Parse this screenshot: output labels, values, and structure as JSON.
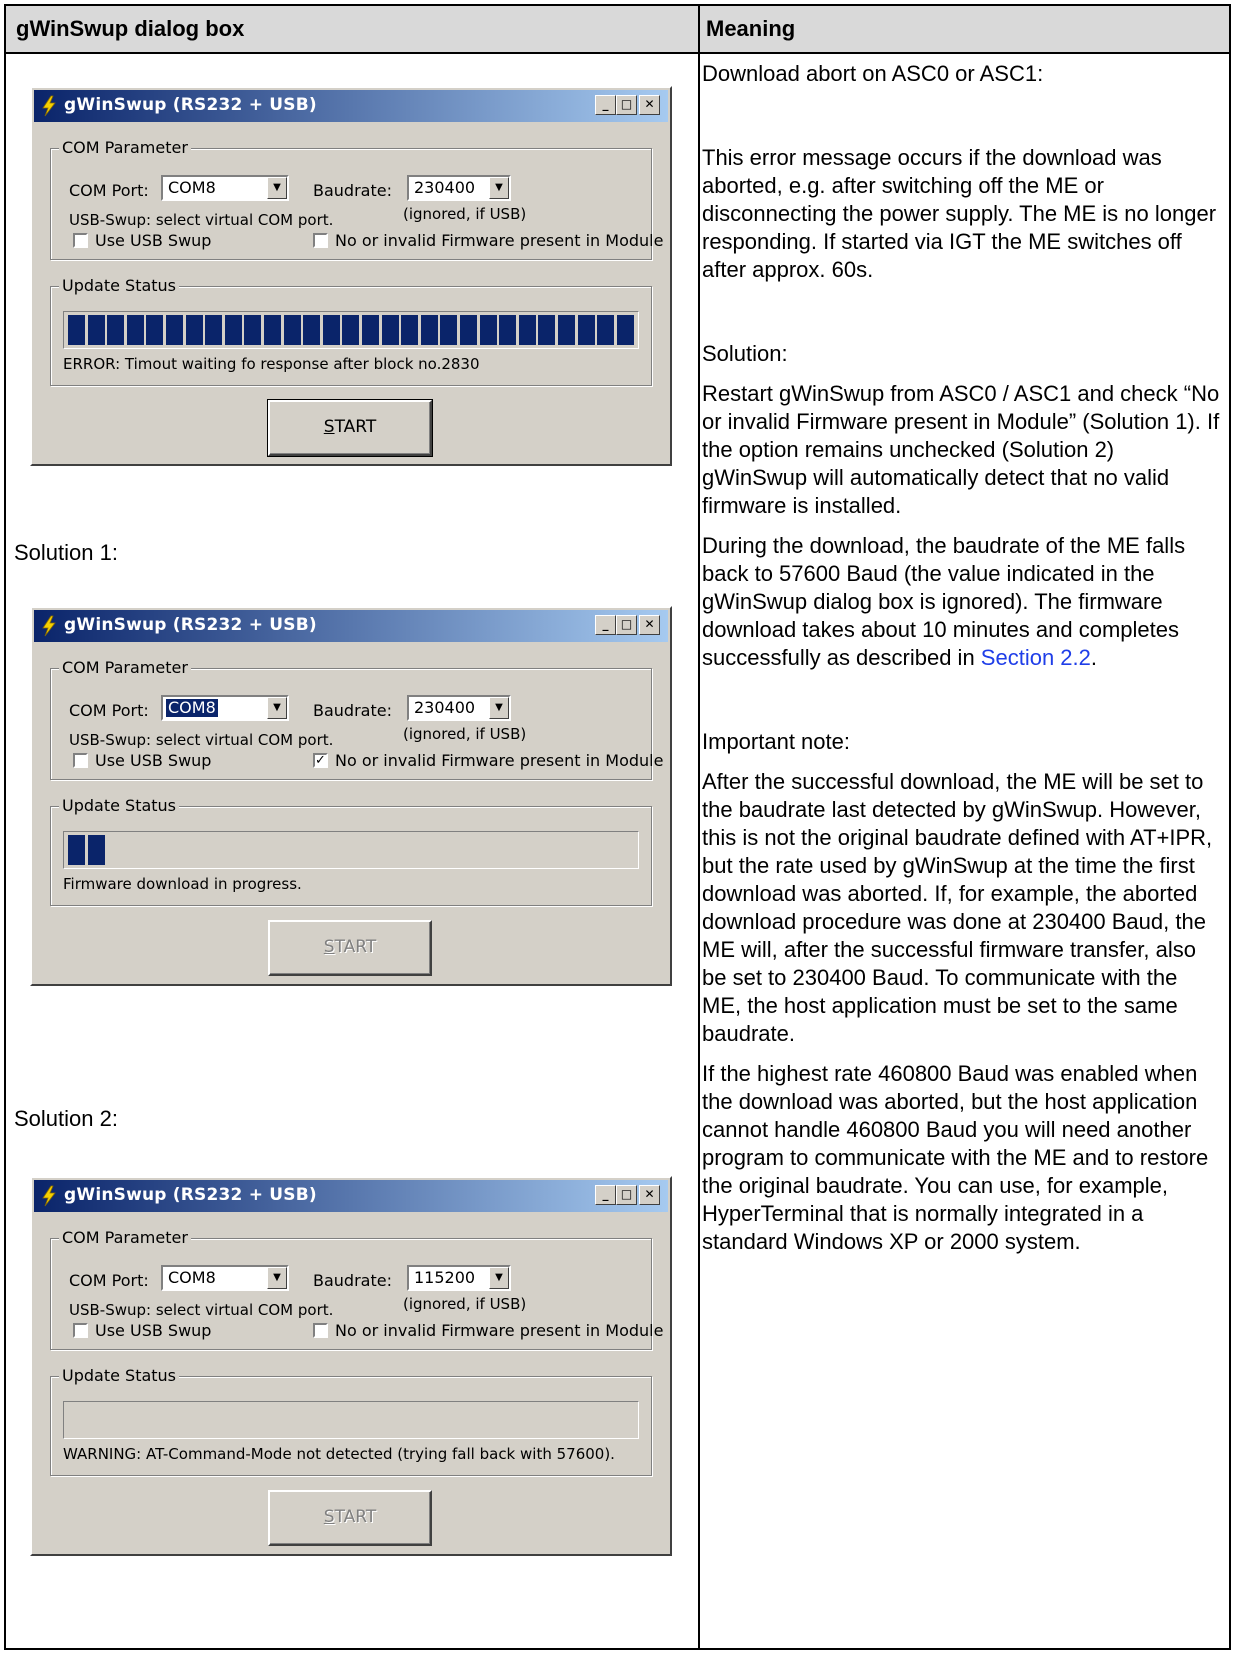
{
  "table": {
    "col1_header": "gWinSwup dialog box",
    "col2_header": "Meaning"
  },
  "dialogs": [
    {
      "title": "gWinSwup (RS232 + USB)",
      "com_group": "COM Parameter",
      "com_port_label": "COM Port:",
      "com_port_value": "COM8",
      "baudrate_label": "Baudrate:",
      "baudrate_value": "230400",
      "usb_hint": "USB-Swup: select virtual COM port.",
      "ignored_hint": "(ignored, if USB)",
      "use_usb_label": "Use USB Swup",
      "use_usb_checked": false,
      "no_fw_label": "No or invalid Firmware present in Module",
      "no_fw_checked": false,
      "status_group": "Update Status",
      "progress_segments": 29,
      "status_text": "ERROR: Timout waiting fo response after block no.2830",
      "start_label": "START",
      "start_accel": "S",
      "start_rest": "TART",
      "start_enabled": true
    },
    {
      "title": "gWinSwup (RS232 + USB)",
      "com_group": "COM Parameter",
      "com_port_label": "COM Port:",
      "com_port_value": "COM8",
      "baudrate_label": "Baudrate:",
      "baudrate_value": "230400",
      "usb_hint": "USB-Swup: select virtual COM port.",
      "ignored_hint": "(ignored, if USB)",
      "use_usb_label": "Use USB Swup",
      "use_usb_checked": false,
      "no_fw_label": "No or invalid Firmware present in Module",
      "no_fw_checked": true,
      "status_group": "Update Status",
      "progress_segments": 2,
      "status_text": "Firmware download in progress.",
      "start_label": "START",
      "start_accel": "S",
      "start_rest": "TART",
      "start_enabled": false
    },
    {
      "title": "gWinSwup (RS232 + USB)",
      "com_group": "COM Parameter",
      "com_port_label": "COM Port:",
      "com_port_value": "COM8",
      "baudrate_label": "Baudrate:",
      "baudrate_value": "115200",
      "usb_hint": "USB-Swup: select virtual COM port.",
      "ignored_hint": "(ignored, if USB)",
      "use_usb_label": "Use USB Swup",
      "use_usb_checked": false,
      "no_fw_label": "No or invalid Firmware present in Module",
      "no_fw_checked": false,
      "status_group": "Update Status",
      "progress_segments": 0,
      "status_text": "WARNING: AT-Command-Mode not detected (trying fall back with 57600).",
      "start_label": "START",
      "start_accel": "S",
      "start_rest": "TART",
      "start_enabled": false
    }
  ],
  "solution_labels": [
    "Solution 1:",
    "Solution 2:"
  ],
  "meaning": {
    "p1": "Download abort on ASC0 or ASC1:",
    "p2": "This error message occurs if the download was aborted, e.g. after switching off the ME or disconnecting the power supply. The ME is no longer responding. If started via IGT the ME switches off after approx. 60s.",
    "p3": "Solution:",
    "p4": "Restart gWinSwup from ASC0 / ASC1 and check “No or invalid Firmware present in Module” (Solution 1). If the option remains unchecked (Solution 2) gWinSwup will automatically detect that no valid firmware is installed.",
    "p5_before": "During the download, the baudrate of the ME falls back to 57600 Baud (the value indicated in the gWinSwup dialog box is ignored). The firmware download takes about 10 minutes and completes successfully as described in ",
    "p5_link": "Section 2.2",
    "p5_after": ".",
    "p6": "Important note:",
    "p7": "After the successful download, the ME will be set to the baudrate last detected by gWinSwup. However, this is not the original baudrate defined with AT+IPR, but the rate used by gWinSwup at the time the first download was aborted. If, for example, the aborted download procedure was done at 230400 Baud, the ME will, after the successful firmware transfer, also be set to 230400 Baud. To communicate with the ME, the host application must be set to the same baudrate.",
    "p8": "If the highest rate 460800 Baud was enabled when the download was aborted, but the host application cannot handle 460800 Baud you will need another program to communicate with the ME and to restore the original baudrate. You can use, for example, HyperTerminal that is normally integrated in a standard Windows XP or 2000 system."
  },
  "icons": {
    "app": "lightning-icon",
    "minimize": "minimize-icon",
    "maximize": "maximize-icon",
    "close": "close-icon",
    "dropdown": "chevron-down-icon",
    "check": "checkmark-icon"
  }
}
